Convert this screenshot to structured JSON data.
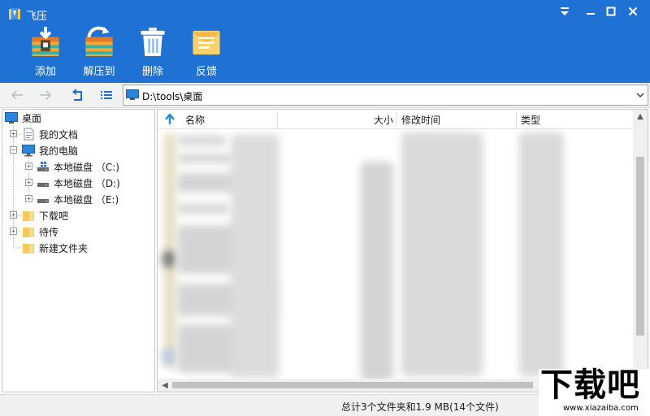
{
  "window": {
    "title": "飞压"
  },
  "toolbar": {
    "add_label": "添加",
    "extract_label": "解压到",
    "delete_label": "删除",
    "feedback_label": "反馈"
  },
  "navigation": {
    "address": "D:\\tools\\桌面"
  },
  "tree": {
    "root": "桌面",
    "items": [
      {
        "label": "我的文档",
        "icon": "documents-icon"
      },
      {
        "label": "我的电脑",
        "icon": "computer-icon"
      },
      {
        "label": "本地磁盘 （C:)",
        "icon": "system-drive-icon"
      },
      {
        "label": "本地磁盘 （D:)",
        "icon": "drive-icon"
      },
      {
        "label": "本地磁盘 （E:)",
        "icon": "drive-icon"
      },
      {
        "label": "下载吧",
        "icon": "folder-icon"
      },
      {
        "label": "待传",
        "icon": "folder-icon"
      },
      {
        "label": "新建文件夹",
        "icon": "folder-icon"
      }
    ]
  },
  "file_list": {
    "columns": {
      "name": "名称",
      "size": "大小",
      "modified": "修改时间",
      "type": "类型"
    }
  },
  "status": {
    "summary": "总计3个文件夹和1.9 MB(14个文件)"
  },
  "watermark": {
    "main": "下载吧",
    "sub": "www.xiazaiba.com"
  },
  "colors": {
    "title_bar": "#1f72d4",
    "folder": "#f5c95a",
    "accent_arrow": "#2a8ae0"
  }
}
